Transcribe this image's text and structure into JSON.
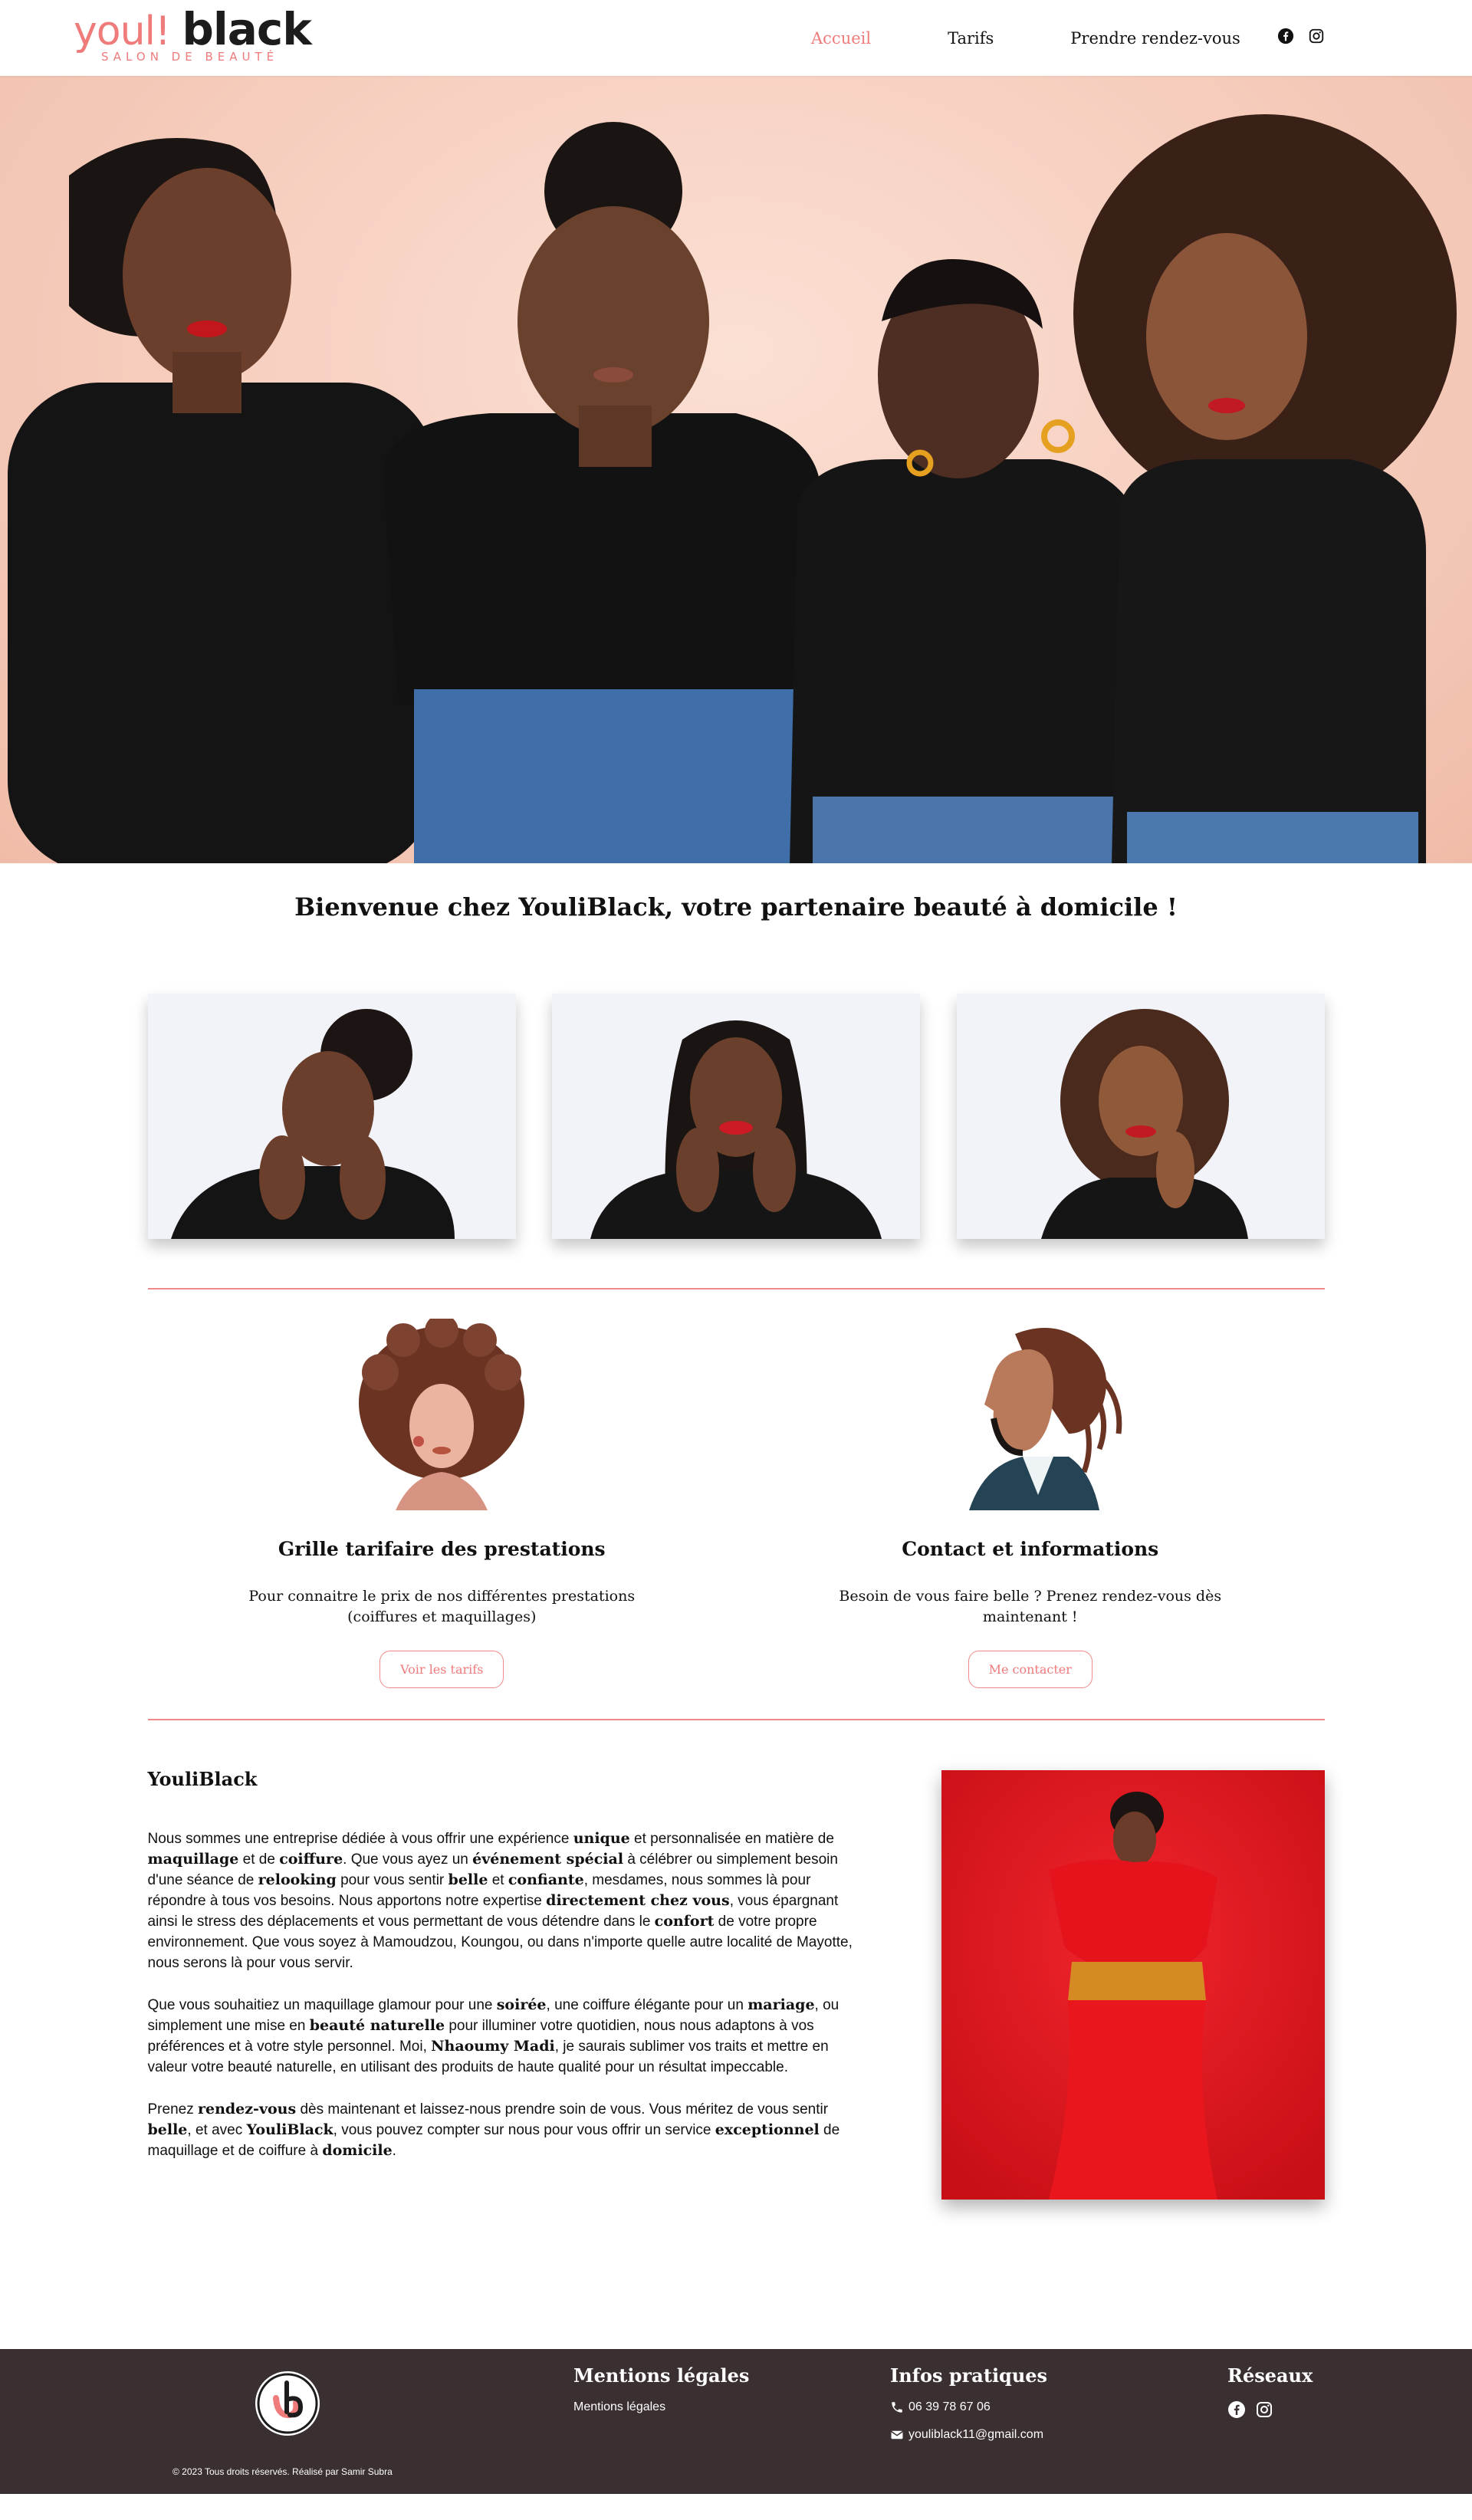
{
  "brand": {
    "logo_text_1": "youl!",
    "logo_text_2": "black",
    "logo_sub": "SALON DE BEAUTÉ"
  },
  "nav": {
    "items": [
      {
        "label": "Accueil",
        "active": true
      },
      {
        "label": "Tarifs",
        "active": false
      },
      {
        "label": "Prendre rendez-vous",
        "active": false
      }
    ],
    "social_icons": [
      "facebook-icon",
      "instagram-icon"
    ]
  },
  "welcome": {
    "title": "Bienvenue chez YouliBlack, votre partenaire beauté à domicile !"
  },
  "cards": [
    {
      "title": "Grille tarifaire des prestations",
      "text": "Pour connaitre le prix de nos différentes prestations (coiffures et maquillages)",
      "button": "Voir les tarifs"
    },
    {
      "title": "Contact et informations",
      "text": "Besoin de vous faire belle ? Prenez rendez-vous dès maintenant !",
      "button": "Me contacter"
    }
  ],
  "about": {
    "title": "YouliBlack",
    "p1": [
      {
        "t": "Nous sommes une entreprise dédiée à vous offrir une expérience "
      },
      {
        "t": "unique",
        "b": true
      },
      {
        "t": " et personnalisée en matière de "
      },
      {
        "t": "maquillage",
        "b": true
      },
      {
        "t": " et de "
      },
      {
        "t": "coiffure",
        "b": true
      },
      {
        "t": ". Que vous ayez un "
      },
      {
        "t": "événement spécial",
        "b": true
      },
      {
        "t": " à célébrer ou simplement besoin d'une séance de "
      },
      {
        "t": "relooking",
        "b": true
      },
      {
        "t": " pour vous sentir "
      },
      {
        "t": "belle",
        "b": true
      },
      {
        "t": " et "
      },
      {
        "t": "confiante",
        "b": true
      },
      {
        "t": ", mesdames, nous sommes là pour répondre à tous vos besoins. Nous apportons notre expertise "
      },
      {
        "t": "directement chez vous",
        "b": true
      },
      {
        "t": ", vous épargnant ainsi le stress des déplacements et vous permettant de vous détendre dans le "
      },
      {
        "t": "confort",
        "b": true
      },
      {
        "t": " de votre propre environnement. Que vous soyez à Mamoudzou, Koungou, ou dans n'importe quelle autre localité de Mayotte, nous serons là pour vous servir."
      }
    ],
    "p2": [
      {
        "t": "Que vous souhaitiez un maquillage glamour pour une "
      },
      {
        "t": "soirée",
        "b": true
      },
      {
        "t": ", une coiffure élégante pour un "
      },
      {
        "t": "mariage",
        "b": true
      },
      {
        "t": ", ou simplement une mise en "
      },
      {
        "t": "beauté naturelle",
        "b": true
      },
      {
        "t": " pour illuminer votre quotidien, nous nous adaptons à vos préférences et à votre style personnel. Moi, "
      },
      {
        "t": "Nhaoumy Madi",
        "b": true
      },
      {
        "t": ", je saurais sublimer vos traits et mettre en valeur votre beauté naturelle, en utilisant des produits de haute qualité pour un résultat impeccable."
      }
    ],
    "p3": [
      {
        "t": "Prenez "
      },
      {
        "t": "rendez-vous",
        "b": true
      },
      {
        "t": " dès maintenant et laissez-nous prendre soin de vous. Vous méritez de vous sentir "
      },
      {
        "t": "belle",
        "b": true
      },
      {
        "t": ", et avec "
      },
      {
        "t": "YouliBlack",
        "b": true
      },
      {
        "t": ", vous pouvez compter sur nous pour vous offrir un service "
      },
      {
        "t": "exceptionnel",
        "b": true
      },
      {
        "t": " de maquillage et de coiffure à "
      },
      {
        "t": "domicile",
        "b": true
      },
      {
        "t": "."
      }
    ]
  },
  "footer": {
    "copyright": "© 2023 Tous droits réservés. Réalisé par Samir Subra",
    "legal_title": "Mentions légales",
    "legal_link": "Mentions légales",
    "info_title": "Infos pratiques",
    "phone": "06 39 78 67 06",
    "email": "youliblack11@gmail.com",
    "social_title": "Réseaux",
    "social_icons": [
      "facebook-icon",
      "instagram-icon"
    ]
  },
  "colors": {
    "accent": "#f07b7b",
    "footer_bg": "#3a2f31",
    "hero_bg": "#f6cdbd",
    "about_photo_bg": "#e8141e"
  }
}
